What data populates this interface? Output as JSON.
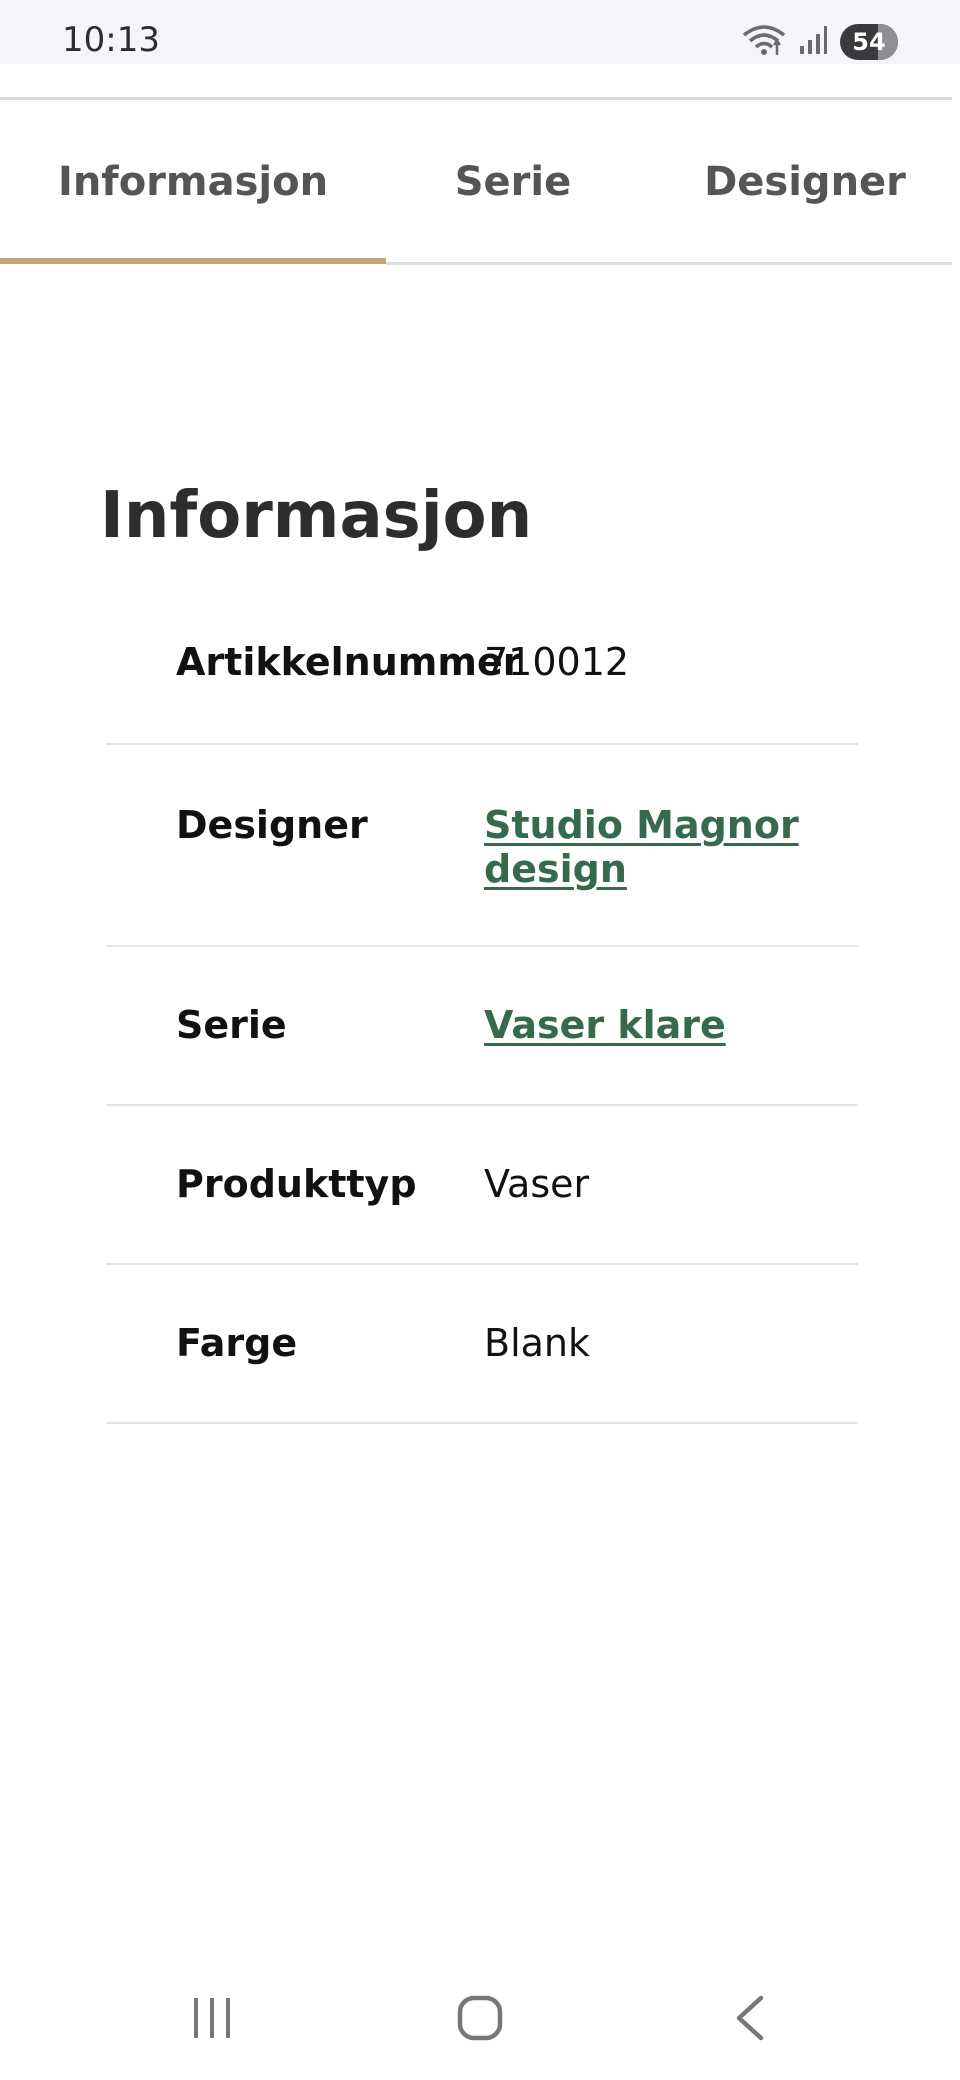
{
  "status_bar": {
    "time": "10:13",
    "battery": "54",
    "icons": [
      "wifi-icon",
      "signal-icon",
      "battery-icon"
    ]
  },
  "tabs": [
    {
      "label": "Informasjon",
      "active": true
    },
    {
      "label": "Serie",
      "active": false
    },
    {
      "label": "Designer",
      "active": false
    }
  ],
  "section": {
    "title": "Informasjon"
  },
  "rows": [
    {
      "label": "Artikkelnummer",
      "value": "710012",
      "link": false
    },
    {
      "label": "Designer",
      "value": "Studio Magnor design",
      "link": true
    },
    {
      "label": "Serie",
      "value": "Vaser klare",
      "link": true
    },
    {
      "label": "Produkttyp",
      "value": "Vaser",
      "link": false
    },
    {
      "label": "Farge",
      "value": "Blank",
      "link": false
    }
  ],
  "nav_bar": {
    "icons": [
      "recents-icon",
      "home-icon",
      "back-icon"
    ]
  },
  "colors": {
    "accent_underline": "#c5a574",
    "link": "#356a4b",
    "status_bar_bg": "#f5f4fb"
  }
}
